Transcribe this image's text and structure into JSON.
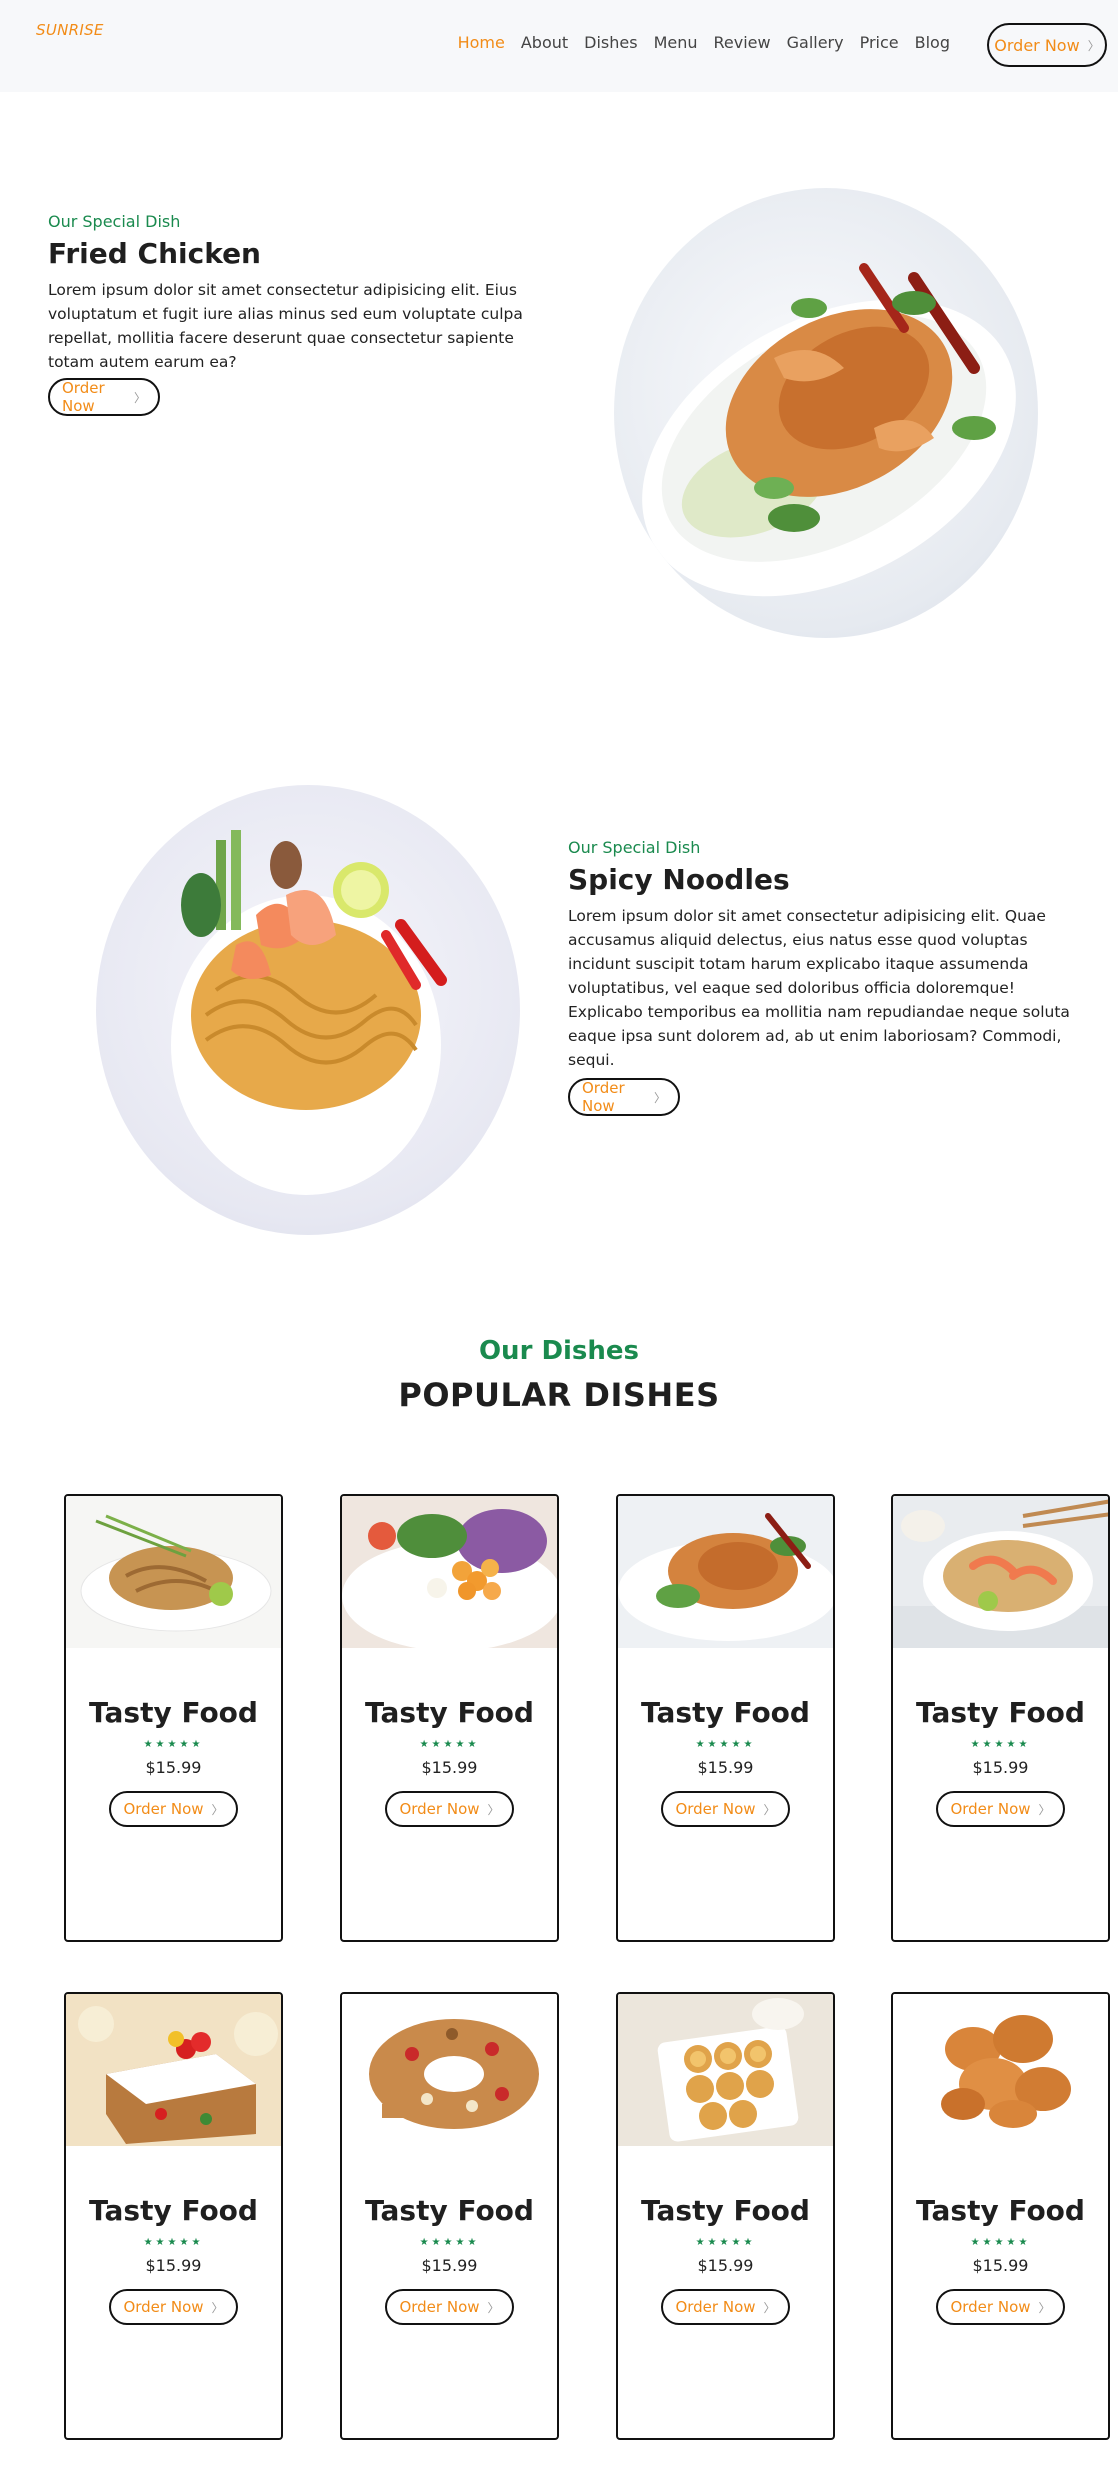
{
  "header": {
    "logo": "SUNRISE",
    "nav": [
      {
        "label": "Home",
        "active": true
      },
      {
        "label": "About",
        "active": false
      },
      {
        "label": "Dishes",
        "active": false
      },
      {
        "label": "Menu",
        "active": false
      },
      {
        "label": "Review",
        "active": false
      },
      {
        "label": "Gallery",
        "active": false
      },
      {
        "label": "Price",
        "active": false
      },
      {
        "label": "Blog",
        "active": false
      }
    ],
    "order_label": "Order Now",
    "order_arrow": "〉"
  },
  "specials": [
    {
      "eyebrow": "Our Special Dish",
      "title": "Fried Chicken",
      "text": "Lorem ipsum dolor sit amet consectetur adipisicing elit. Eius voluptatum et fugit iure alias minus sed eum voluptate culpa repellat, mollitia facere deserunt quae consectetur sapiente totam autem earum ea?",
      "button": "Order Now",
      "arrow": "〉"
    },
    {
      "eyebrow": "Our Special Dish",
      "title": "Spicy Noodles",
      "text": "Lorem ipsum dolor sit amet consectetur adipisicing elit. Quae accusamus aliquid delectus, eius natus esse quod voluptas incidunt suscipit totam harum explicabo itaque assumenda voluptatibus, vel eaque sed doloribus officia doloremque! Explicabo temporibus ea mollitia nam repudiandae neque soluta eaque ipsa sunt dolorem ad, ab ut enim laboriosam? Commodi, sequi.",
      "button": "Order Now",
      "arrow": "〉"
    }
  ],
  "dishes_section": {
    "subtitle": "Our Dishes",
    "title": "POPULAR DISHES"
  },
  "cards": [
    {
      "title": "Tasty Food",
      "stars": "★★★★★",
      "price": "$15.99",
      "button": "Order Now",
      "arrow": "〉",
      "image": "pad-thai-plate"
    },
    {
      "title": "Tasty Food",
      "stars": "★★★★★",
      "price": "$15.99",
      "button": "Order Now",
      "arrow": "〉",
      "image": "mixed-salad-plate"
    },
    {
      "title": "Tasty Food",
      "stars": "★★★★★",
      "price": "$15.99",
      "button": "Order Now",
      "arrow": "〉",
      "image": "chicken-salad-bowl"
    },
    {
      "title": "Tasty Food",
      "stars": "★★★★★",
      "price": "$15.99",
      "button": "Order Now",
      "arrow": "〉",
      "image": "shrimp-noodle-bowl"
    },
    {
      "title": "Tasty Food",
      "stars": "★★★★★",
      "price": "$15.99",
      "button": "Order Now",
      "arrow": "〉",
      "image": "fruit-cake"
    },
    {
      "title": "Tasty Food",
      "stars": "★★★★★",
      "price": "$15.99",
      "button": "Order Now",
      "arrow": "〉",
      "image": "ring-fruit-cake"
    },
    {
      "title": "Tasty Food",
      "stars": "★★★★★",
      "price": "$15.99",
      "button": "Order Now",
      "arrow": "〉",
      "image": "egg-tarts-tray"
    },
    {
      "title": "Tasty Food",
      "stars": "★★★★★",
      "price": "$15.99",
      "button": "Order Now",
      "arrow": "〉",
      "image": "fried-chicken-pieces"
    }
  ],
  "colors": {
    "accent": "#f28c18",
    "green": "#1a8a4e",
    "header_bg": "#f7f8fa",
    "text": "#1f1f1f"
  }
}
